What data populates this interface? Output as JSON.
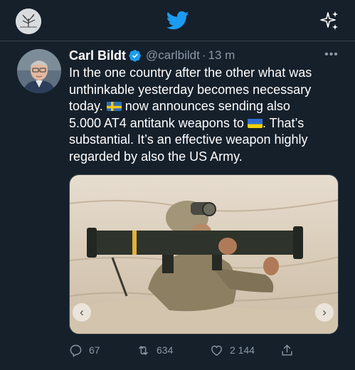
{
  "colors": {
    "background": "#15202b",
    "accent": "#1d9bf0",
    "secondary_text": "#8b98a5",
    "divider": "#38444d"
  },
  "topbar": {
    "logo_icon": "twitter-bird-icon",
    "sparkle_icon": "sparkle-icon",
    "profile_icon": "profile-avatar"
  },
  "tweet": {
    "author_name": "Carl Bildt",
    "verified": true,
    "handle": "@carlbildt",
    "separator": "·",
    "time": "13 m",
    "more_label": "•••",
    "text_lines": [
      {
        "before": "In the one country after the other what was"
      },
      {
        "before": "unthinkable yesterday becomes necessary"
      },
      {
        "before": "today. ",
        "flag": "sweden-flag",
        "after": " now announces sending also"
      },
      {
        "before": "5.000 AT4 antitank weapons to ",
        "flag": "ukraine-flag",
        "after": ". That’s"
      },
      {
        "before": "substantial. It’s an effective weapon highly"
      },
      {
        "before": "regarded by also the US Army."
      }
    ],
    "media": {
      "nav_prev": "‹",
      "nav_next": "›"
    },
    "actions": {
      "replies": "67",
      "retweets": "634",
      "likes": "2 144"
    }
  }
}
